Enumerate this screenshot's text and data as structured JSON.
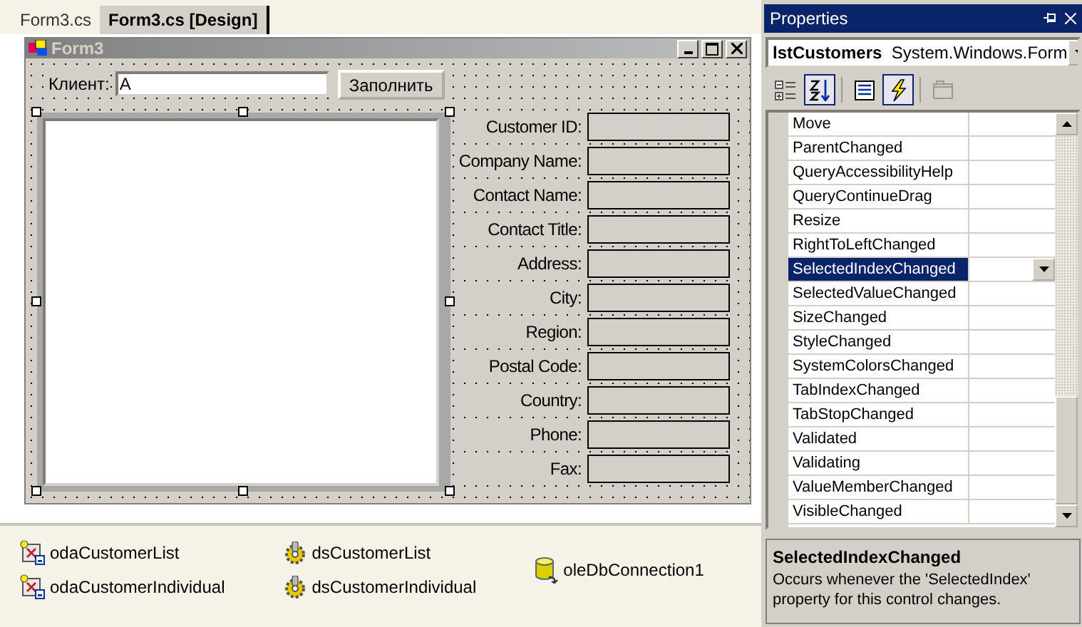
{
  "tabs": [
    {
      "label": "Form3.cs",
      "selected": false
    },
    {
      "label": "Form3.cs [Design]",
      "selected": true
    }
  ],
  "form": {
    "title": "Form3",
    "client_label": "Клиент:",
    "client_value": "A",
    "fill_button": "Заполнить",
    "fields": [
      {
        "label": "Customer ID:"
      },
      {
        "label": "Company Name:"
      },
      {
        "label": "Contact Name:"
      },
      {
        "label": "Contact Title:"
      },
      {
        "label": "Address:"
      },
      {
        "label": "City:"
      },
      {
        "label": "Region:"
      },
      {
        "label": "Postal Code:"
      },
      {
        "label": "Country:"
      },
      {
        "label": "Phone:"
      },
      {
        "label": "Fax:"
      }
    ]
  },
  "tray": [
    {
      "name": "odaCustomerList",
      "kind": "adapter"
    },
    {
      "name": "odaCustomerIndividual",
      "kind": "adapter"
    },
    {
      "name": "dsCustomerList",
      "kind": "dataset"
    },
    {
      "name": "dsCustomerIndividual",
      "kind": "dataset"
    },
    {
      "name": "oleDbConnection1",
      "kind": "connection"
    }
  ],
  "properties": {
    "title": "Properties",
    "object": "lstCustomers",
    "type": "System.Windows.Form",
    "toolbar": [
      {
        "kind": "categorized",
        "selected": false
      },
      {
        "kind": "alphabetical",
        "selected": true
      },
      {
        "kind": "properties",
        "selected": false
      },
      {
        "kind": "events",
        "selected": true
      },
      {
        "kind": "pages",
        "selected": false
      }
    ],
    "events": [
      {
        "name": "Move",
        "selected": false
      },
      {
        "name": "ParentChanged",
        "selected": false
      },
      {
        "name": "QueryAccessibilityHelp",
        "selected": false
      },
      {
        "name": "QueryContinueDrag",
        "selected": false
      },
      {
        "name": "Resize",
        "selected": false
      },
      {
        "name": "RightToLeftChanged",
        "selected": false
      },
      {
        "name": "SelectedIndexChanged",
        "selected": true
      },
      {
        "name": "SelectedValueChanged",
        "selected": false
      },
      {
        "name": "SizeChanged",
        "selected": false
      },
      {
        "name": "StyleChanged",
        "selected": false
      },
      {
        "name": "SystemColorsChanged",
        "selected": false
      },
      {
        "name": "TabIndexChanged",
        "selected": false
      },
      {
        "name": "TabStopChanged",
        "selected": false
      },
      {
        "name": "Validated",
        "selected": false
      },
      {
        "name": "Validating",
        "selected": false
      },
      {
        "name": "ValueMemberChanged",
        "selected": false
      },
      {
        "name": "VisibleChanged",
        "selected": false
      }
    ],
    "description": {
      "title": "SelectedIndexChanged",
      "text": "Occurs whenever the 'SelectedIndex' property for this control changes."
    }
  }
}
